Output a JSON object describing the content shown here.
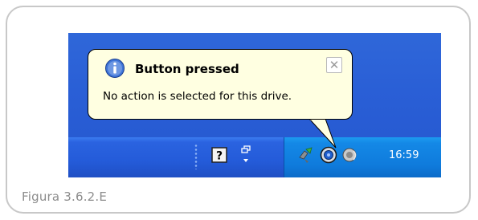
{
  "balloon": {
    "title": "Button pressed",
    "message": "No action is selected for this drive.",
    "close_glyph": "✕",
    "icon": "info-icon"
  },
  "taskbar": {
    "clock": "16:59",
    "help_glyph": "?",
    "icons": [
      "help-icon",
      "network-icon",
      "safely-remove-hardware-icon",
      "drive-icon",
      "volume-icon"
    ]
  },
  "caption": "Figura 3.6.2.E",
  "colors": {
    "taskbar": "#245bd9",
    "tray": "#0f7bdc",
    "balloon_bg": "#ffffe1",
    "caption": "#8c8c8c"
  }
}
